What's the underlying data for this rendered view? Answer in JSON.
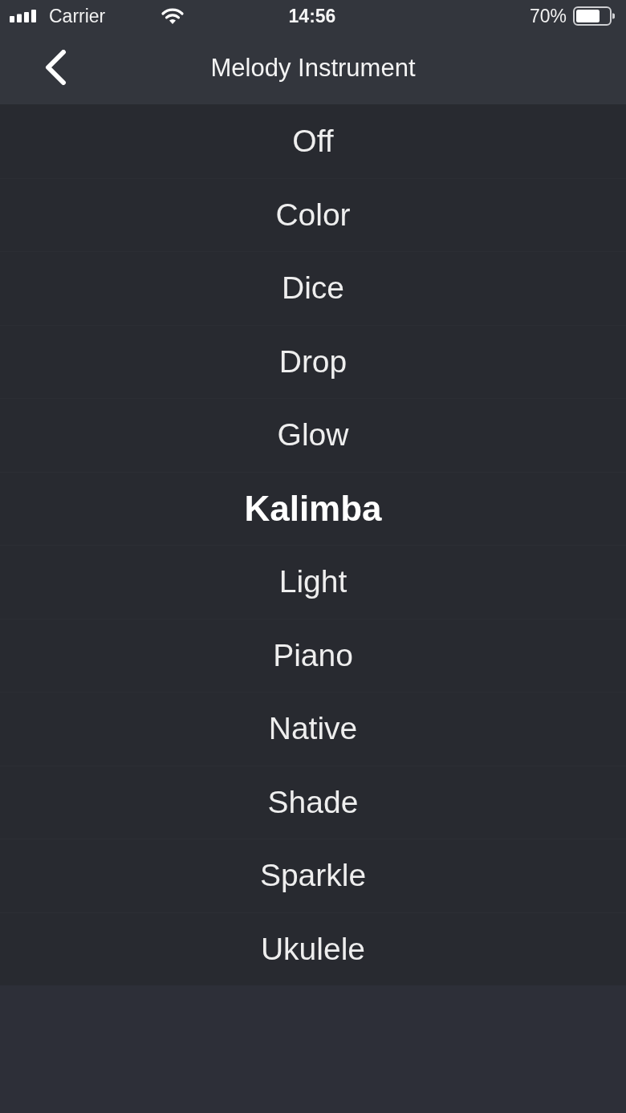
{
  "status_bar": {
    "carrier": "Carrier",
    "time": "14:56",
    "battery": "70%"
  },
  "nav_bar": {
    "title": "Melody Instrument"
  },
  "options": [
    {
      "label": "Off",
      "selected": false
    },
    {
      "label": "Color",
      "selected": false
    },
    {
      "label": "Dice",
      "selected": false
    },
    {
      "label": "Drop",
      "selected": false
    },
    {
      "label": "Glow",
      "selected": false
    },
    {
      "label": "Kalimba",
      "selected": true
    },
    {
      "label": "Light",
      "selected": false
    },
    {
      "label": "Piano",
      "selected": false
    },
    {
      "label": "Native",
      "selected": false
    },
    {
      "label": "Shade",
      "selected": false
    },
    {
      "label": "Sparkle",
      "selected": false
    },
    {
      "label": "Ukulele",
      "selected": false
    }
  ]
}
